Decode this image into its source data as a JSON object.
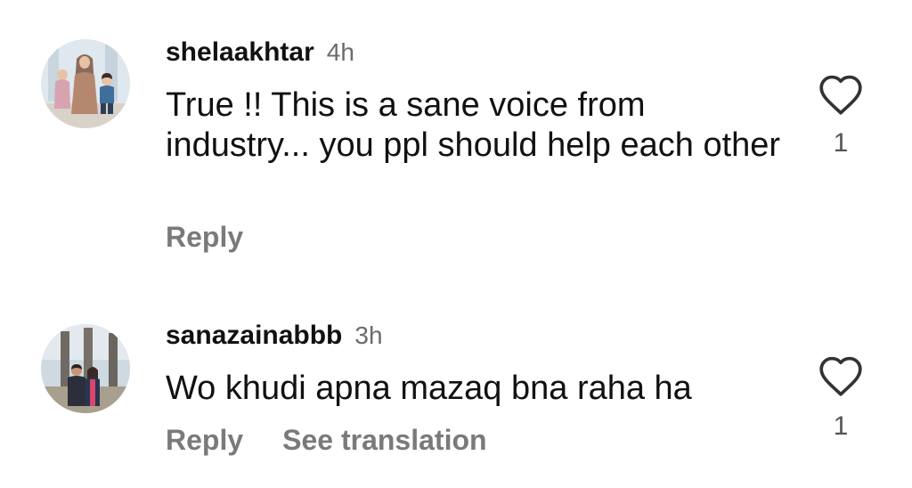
{
  "comments": [
    {
      "username": "shelaakhtar",
      "time": "4h",
      "text": "True !! This is a sane voice from industry... you ppl should help each other",
      "reply_label": "Reply",
      "like_count": "1"
    },
    {
      "username": "sanazainabbb",
      "time": "3h",
      "text": "Wo khudi apna mazaq bna raha ha",
      "reply_label": "Reply",
      "translate_label": "See translation",
      "like_count": "1"
    }
  ],
  "icons": {
    "like": "heart-outline-icon"
  },
  "colors": {
    "text": "#111111",
    "secondary_text": "#7a7a7a",
    "timestamp": "#6b6b6b"
  }
}
